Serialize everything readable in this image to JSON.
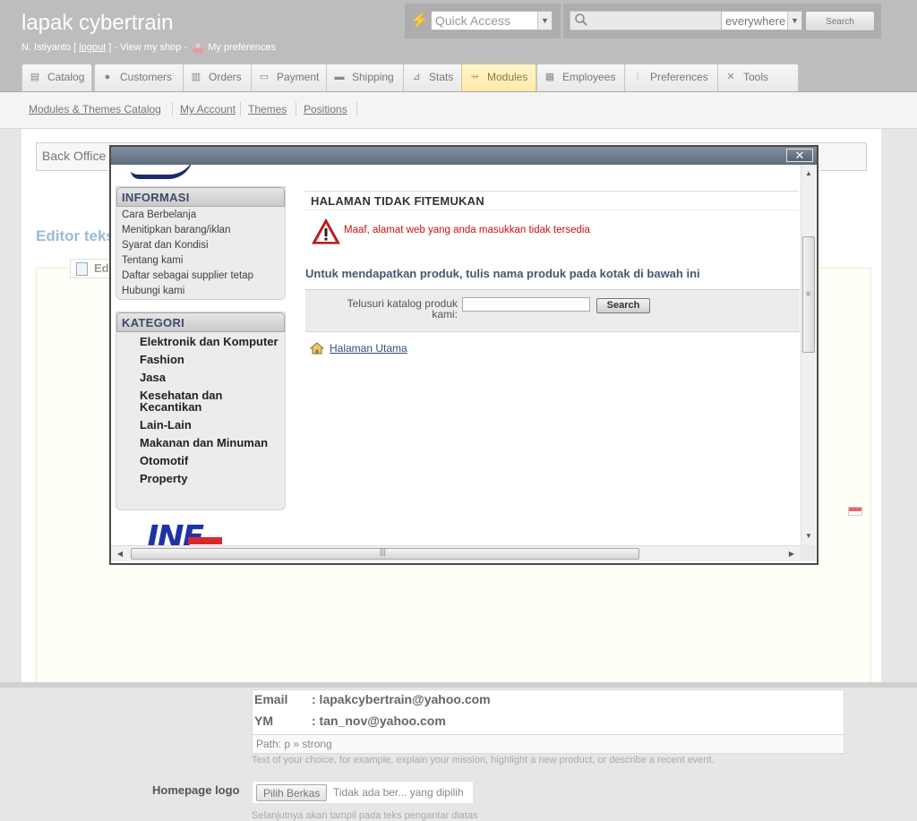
{
  "header": {
    "shop_title": "lapak cybertrain",
    "user_name": "N. Istiyanto [",
    "logout": "logout",
    "view_shop": "] - View my shop -",
    "preferences": "My preferences",
    "quick_access": "Quick Access",
    "search_scope": "everywhere",
    "search_button": "Search"
  },
  "tabs": [
    {
      "label": "Catalog",
      "icon": "book-icon"
    },
    {
      "label": "Customers",
      "icon": "person-icon"
    },
    {
      "label": "Orders",
      "icon": "cart-icon"
    },
    {
      "label": "Payment",
      "icon": "card-icon"
    },
    {
      "label": "Shipping",
      "icon": "truck-icon"
    },
    {
      "label": "Stats",
      "icon": "chart-icon"
    },
    {
      "label": "Modules",
      "icon": "puzzle-icon",
      "active": true
    },
    {
      "label": "Employees",
      "icon": "building-icon"
    },
    {
      "label": "Preferences",
      "icon": "sliders-icon"
    },
    {
      "label": "Tools",
      "icon": "wrench-icon"
    }
  ],
  "subnav": [
    "Modules & Themes Catalog",
    "My Account",
    "Themes",
    "Positions"
  ],
  "background": {
    "bo_label": "Back Office",
    "editor_title": "Editor teks",
    "editor_legend": "Editor",
    "email_label": "Email",
    "email_value": ": lapakcybertrain@yahoo.com",
    "ym_label": "YM",
    "ym_value": ": tan_nov@yahoo.com",
    "path": "Path: p » strong",
    "hint": "Text of your choice, for example, explain your mission, highlight a new product, or describe a recent event.",
    "logo_label": "Homepage logo",
    "file_button": "Pilih Berkas",
    "file_text": "Tidak ada ber... yang dipilih",
    "hint2": "Selanjutnya akan tampil pada teks pengantar diatas"
  },
  "popup": {
    "close": "✕",
    "sidebar": {
      "info_title": "INFORMASI",
      "info_items": [
        "Cara Berbelanja",
        "Menitipkan barang/iklan",
        "Syarat dan Kondisi",
        "Tentang kami",
        "Daftar sebagai supplier tetap",
        "Hubungi kami"
      ],
      "cat_title": "KATEGORI",
      "cat_items": [
        "Elektronik dan Komputer",
        "Fashion",
        "Jasa",
        "Kesehatan dan Kecantikan",
        "Lain-Lain",
        "Makanan dan Minuman",
        "Otomotif",
        "Property"
      ],
      "logo_text": "INF"
    },
    "main": {
      "page_heading": "HALAMAN TIDAK FITEMUKAN",
      "error_message": "Maaf, alamat web yang anda masukkan tidak tersedia",
      "subtitle": "Untuk mendapatkan produk, tulis nama produk pada kotak di bawah ini",
      "search_label": "Telusuri katalog produk kami:",
      "search_value": "",
      "search_button": "Search",
      "home_link": "Halaman Utama"
    }
  }
}
